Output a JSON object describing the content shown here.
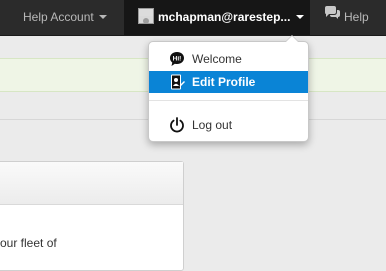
{
  "topbar": {
    "help_account_label": "Help Account",
    "user_label": "mchapman@rarestep...",
    "help_label": "Help"
  },
  "content": {
    "panel_text": "our fleet of"
  },
  "user_menu": {
    "items": [
      {
        "label": "Welcome",
        "icon": "speech-bubble-hi-icon"
      },
      {
        "label": "Edit Profile",
        "icon": "profile-card-icon",
        "selected": true
      },
      {
        "label": "Log out",
        "icon": "power-icon"
      }
    ]
  },
  "colors": {
    "topbar_bg": "#2b2b2b",
    "active_user_bg": "#161616",
    "menu_highlight": "#0a84d6",
    "alert_bg": "#eff5e6"
  }
}
